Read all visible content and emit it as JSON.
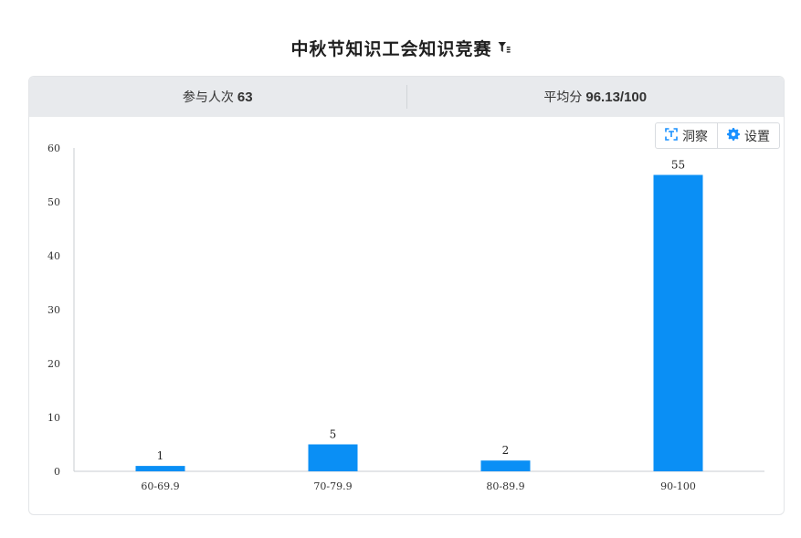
{
  "title": "中秋节知识工会知识竞赛",
  "filter_icon": "filter-icon",
  "stats": {
    "participants_label": "参与人次",
    "participants_value": "63",
    "average_label": "平均分",
    "average_value": "96.13/100"
  },
  "toolbar": {
    "insight_label": "洞察",
    "insight_icon": "scan-icon",
    "settings_label": "设置",
    "settings_icon": "gear-icon"
  },
  "colors": {
    "bar": "#0a8ff5",
    "accent": "#1890ff",
    "header_bg": "#e8eaed"
  },
  "chart_data": {
    "type": "bar",
    "categories": [
      "60-69.9",
      "70-79.9",
      "80-89.9",
      "90-100"
    ],
    "values": [
      1,
      5,
      2,
      55
    ],
    "ylim": [
      0,
      60
    ],
    "yticks": [
      0,
      10,
      20,
      30,
      40,
      50,
      60
    ],
    "grid": false,
    "legend": "none",
    "data_labels": true
  }
}
